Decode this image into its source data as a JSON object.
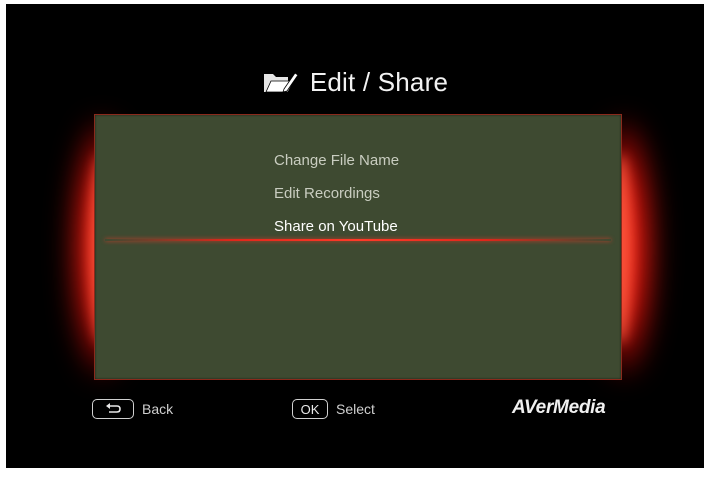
{
  "header": {
    "title": "Edit / Share",
    "icon": "folder-edit-icon"
  },
  "menu": {
    "items": [
      {
        "label": "Change File Name",
        "selected": false
      },
      {
        "label": "Edit Recordings",
        "selected": false
      },
      {
        "label": "Share on YouTube",
        "selected": true
      }
    ]
  },
  "footer": {
    "back_label": "Back",
    "back_icon": "return-arrow-icon",
    "ok_key": "OK",
    "select_label": "Select",
    "brand": "AVerMedia"
  },
  "colors": {
    "background": "#000000",
    "panel": "#3e4a31",
    "glow": "#e0261a",
    "text": "#f2f2f2"
  }
}
